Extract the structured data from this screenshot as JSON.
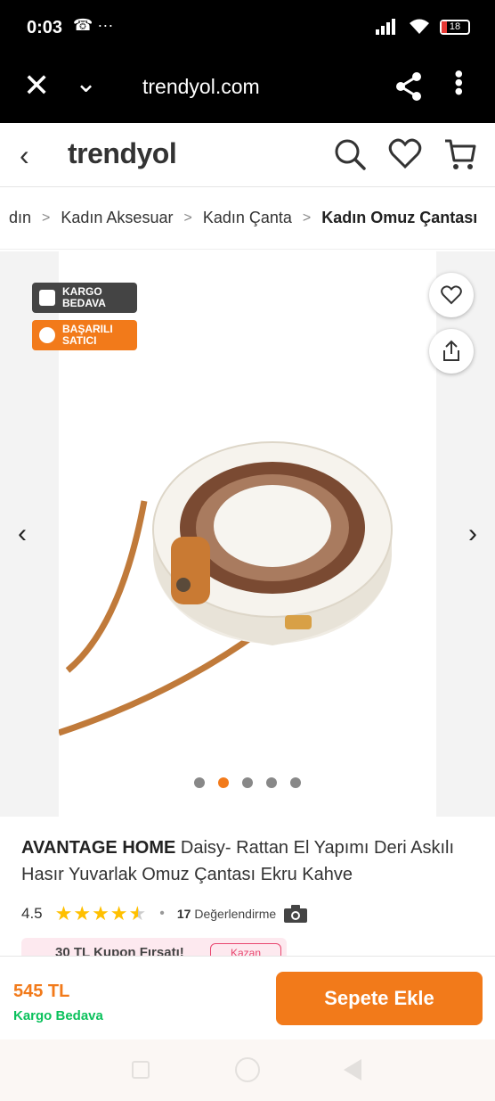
{
  "status_bar": {
    "time": "0:03",
    "left_icons": "☎ ···",
    "signal": "4G",
    "battery": "18"
  },
  "browser": {
    "url": "trendyol.com"
  },
  "site": {
    "logo": "trendyol"
  },
  "breadcrumb": {
    "items": [
      "dın",
      "Kadın Aksesuar",
      "Kadın Çanta",
      "Kadın Omuz Çantası"
    ],
    "separator": ">"
  },
  "badges": {
    "kargo": "KARGO BEDAVA",
    "satici": "BAŞARILI SATICI"
  },
  "gallery": {
    "image_count": 5,
    "active_index": 1,
    "prev": "‹",
    "next": "›"
  },
  "product": {
    "brand": "AVANTAGE HOME",
    "name": "Daisy- Rattan El Yapımı Deri Askılı Hasır Yuvarlak Omuz Çantası Ekru Kahve",
    "rating": "4.5",
    "rating_value": 4.5,
    "review_count": "17",
    "review_label": "Değerlendirme"
  },
  "coupon": {
    "text": "30 TL Kupon Fırsatı!",
    "button": "Kazan"
  },
  "footer": {
    "price": "545 TL",
    "shipping": "Kargo Bedava",
    "add_to_cart": "Sepete Ekle"
  },
  "colors": {
    "accent": "#f27a1a",
    "green": "#0bc15c",
    "star": "#ffc000"
  }
}
